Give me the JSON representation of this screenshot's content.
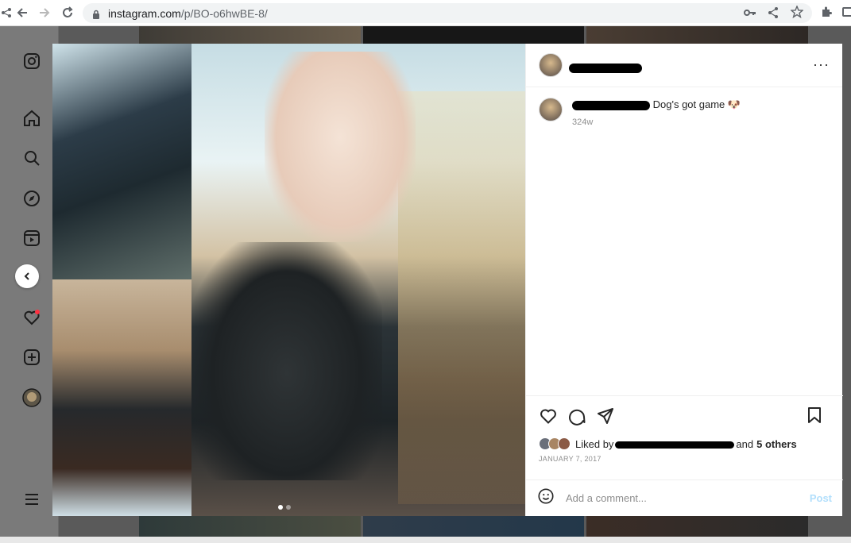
{
  "browser": {
    "url_host": "instagram.com",
    "url_path": "/p/BO-o6hwBE-8/"
  },
  "sidebar": {
    "items": [
      {
        "icon": "instagram-logo-icon"
      },
      {
        "icon": "home-icon"
      },
      {
        "icon": "search-icon"
      },
      {
        "icon": "explore-icon"
      },
      {
        "icon": "reels-icon"
      },
      {
        "icon": "notifications-heart-icon"
      },
      {
        "icon": "create-icon"
      },
      {
        "icon": "profile-avatar"
      },
      {
        "icon": "menu-icon"
      }
    ]
  },
  "post": {
    "caption_text": "Dog's got game 🐶",
    "time_ago": "324w",
    "liked_by_prefix": "Liked by",
    "liked_by_conj": "and",
    "others": "5 others",
    "date": "JANUARY 7, 2017",
    "comment_placeholder": "Add a comment...",
    "post_label": "Post",
    "more_label": "···"
  },
  "colors": {
    "post_button": "#b2dffc",
    "notification_dot": "#ff3040",
    "modal_bg": "#ffffff"
  }
}
